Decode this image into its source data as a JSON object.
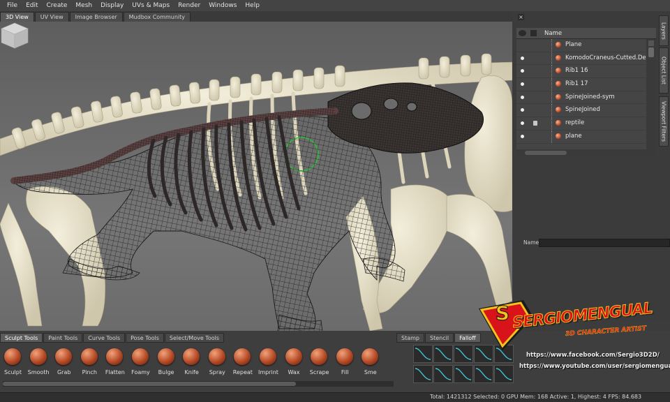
{
  "menu": [
    "File",
    "Edit",
    "Create",
    "Mesh",
    "Display",
    "UVs & Maps",
    "Render",
    "Windows",
    "Help"
  ],
  "view_tabs": [
    "3D View",
    "UV View",
    "Image Browser",
    "Mudbox Community"
  ],
  "object_list": {
    "header": "Name",
    "items": [
      {
        "name": "Plane",
        "visible": false,
        "locked": false
      },
      {
        "name": "KomodoCraneus-Cutted.De...",
        "visible": true,
        "locked": false
      },
      {
        "name": "Rib1 16",
        "visible": true,
        "locked": false
      },
      {
        "name": "Rib1 17",
        "visible": true,
        "locked": false
      },
      {
        "name": "SpineJoined-sym",
        "visible": true,
        "locked": false
      },
      {
        "name": "SpineJoined",
        "visible": true,
        "locked": false
      },
      {
        "name": "reptile",
        "visible": true,
        "locked": true
      },
      {
        "name": "plane",
        "visible": true,
        "locked": false
      }
    ]
  },
  "side_tabs": [
    "Layers",
    "Object List",
    "Viewport Filters"
  ],
  "name_field": {
    "label": "Name",
    "value": ""
  },
  "tool_tabs": [
    "Sculpt Tools",
    "Paint Tools",
    "Curve Tools",
    "Pose Tools",
    "Select/Move Tools"
  ],
  "sculpt_tools": [
    "Sculpt",
    "Smooth",
    "Grab",
    "Pinch",
    "Flatten",
    "Foamy",
    "Bulge",
    "Knife",
    "Spray",
    "Repeat",
    "Imprint",
    "Wax",
    "Scrape",
    "Fill",
    "Sme"
  ],
  "stamp_tabs": [
    "Stamp",
    "Stencil",
    "Falloff"
  ],
  "status": "Total: 1421312  Selected: 0 GPU Mem: 168  Active: 1, Highest: 4  FPS: 84.683",
  "watermark": {
    "logo_line1": "SERGIOMENGUAL",
    "logo_line2": "3D CHARACTER ARTIST",
    "facebook": "https://www.facebook.com/Sergio3D2D/",
    "youtube": "https://www.youtube.com/user/sergiomengual"
  }
}
